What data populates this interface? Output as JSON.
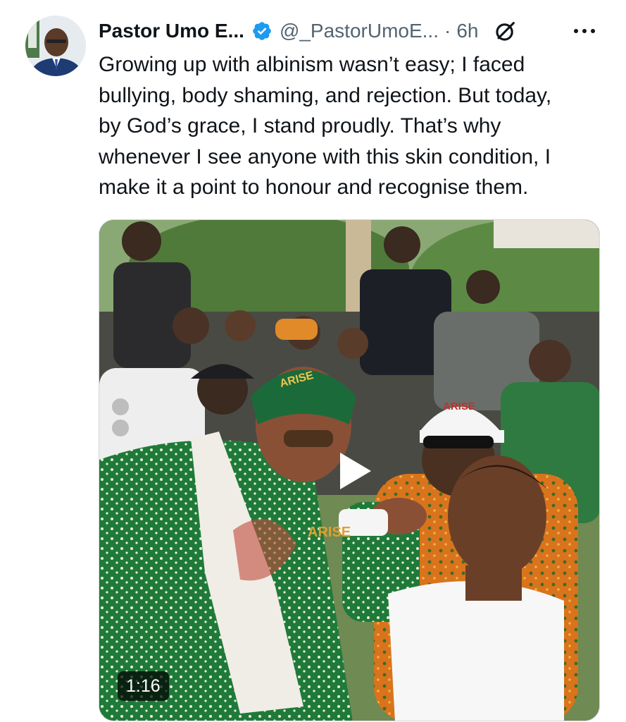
{
  "post": {
    "author_name": "Pastor Umo E...",
    "handle": "@_PastorUmoE...",
    "separator": "·",
    "time": "6h",
    "text_lines": [
      "Growing up with albinism wasn’t easy; I faced",
      "bullying, body shaming, and rejection. But today,",
      "by God’s grace, I stand proudly. That’s why",
      "whenever I see anyone with this skin condition, I",
      "make it a point to honour and recognise them."
    ]
  },
  "media": {
    "duration": "1:16",
    "cap_white_text": "ARISE",
    "cap_green_text": "ARISE",
    "fabric_text": "ARISE"
  },
  "icons": {
    "verified": "verified-badge-icon",
    "grok": "grok-icon",
    "more": "more-options-icon",
    "play": "play-icon"
  },
  "colors": {
    "verified": "#1d9bf0",
    "secondary_text": "#536471",
    "primary_text": "#0f1419"
  }
}
